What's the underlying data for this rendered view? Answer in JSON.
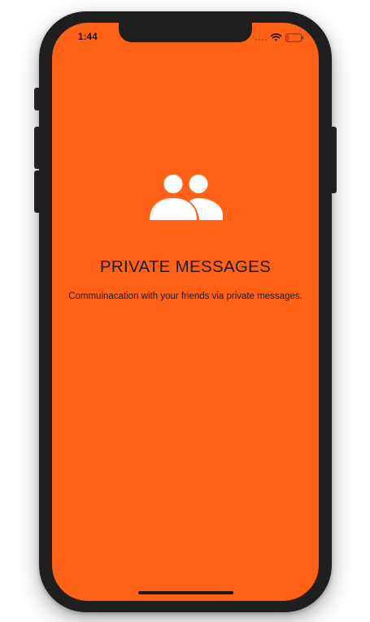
{
  "status_bar": {
    "time": "1:44",
    "icons": [
      "signal-icon",
      "wifi-icon",
      "battery-icon"
    ],
    "battery_level": 0.12
  },
  "onboarding": {
    "icon": "users-icon",
    "title": "PRIVATE MESSAGES",
    "subtitle": "Commuinacation with your friends via private messages."
  },
  "colors": {
    "screen_background": "#FF6117",
    "icon": "#FFFFFF",
    "text": "#1C1C1C",
    "device_frame": "#1F1F1F",
    "battery_low": "#E5281A"
  }
}
